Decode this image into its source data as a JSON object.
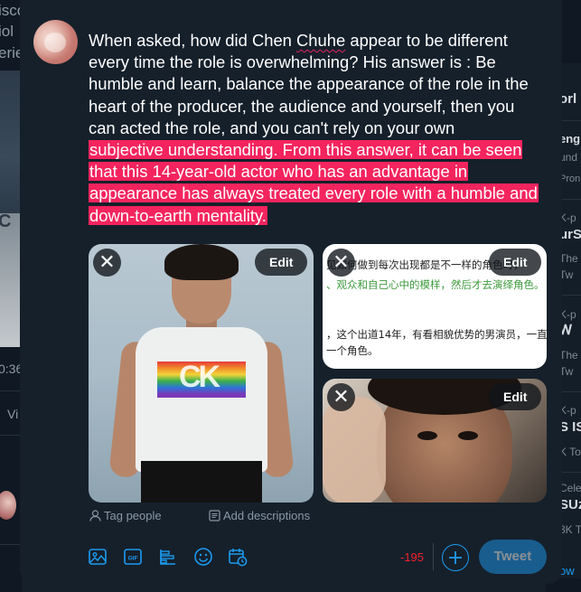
{
  "background_left": {
    "lines": [
      "isco",
      "iol",
      "erie",
      "C",
      "0:36",
      "Vi"
    ]
  },
  "background_right": {
    "items": [
      "orl",
      "eng",
      "und",
      "Pron",
      "K-p",
      "urS",
      "The",
      "Tw",
      "K-p",
      "Ꮃ",
      "The",
      "Tw",
      "K-p",
      "S IS",
      "K To",
      "Cele",
      "SUz",
      "3K T",
      "ow"
    ]
  },
  "tweet": {
    "lines": [
      {
        "pre": "When asked, how did Chen ",
        "flag": "Chuhe",
        "post": " appear to be different"
      },
      {
        "pre": "every time the role is overwhelming? His answer is : Be"
      },
      {
        "pre": "humble and learn, balance the appearance of the role in the"
      },
      {
        "pre": "heart of the producer, the audience and yourself, then you"
      },
      {
        "pre": "can acted the role, and you can't rely on your own"
      }
    ],
    "over_lines": [
      "subjective understanding. From this answer, it can be seen",
      "that this 14-year-old actor who has an advantage in",
      "appearance has always treated every role with a humble and",
      "down-to-earth mentality."
    ]
  },
  "media": {
    "edit_label": "Edit",
    "close_symbol": "✕",
    "logo_text": "CK",
    "text_image_lines": [
      "见如何做到每次出现都是不一样的角色时，",
      "、观众和自己心中的模样，然后才去演绎角色。",
      "，这个出道14年，有看相貌优势的男演员，一直",
      "一个角色。"
    ]
  },
  "media_actions": {
    "tag_people": "Tag people",
    "add_descriptions": "Add descriptions"
  },
  "toolbar": {
    "icons": [
      "image-icon",
      "gif-icon",
      "poll-icon",
      "emoji-icon",
      "schedule-icon"
    ],
    "char_counter": "-195",
    "tweet_label": "Tweet"
  },
  "colors": {
    "background": "#15202b",
    "accent": "#1d9bf0",
    "overflow_highlight": "#f4245e",
    "counter": "#f4212e",
    "muted": "#8b98a5"
  }
}
